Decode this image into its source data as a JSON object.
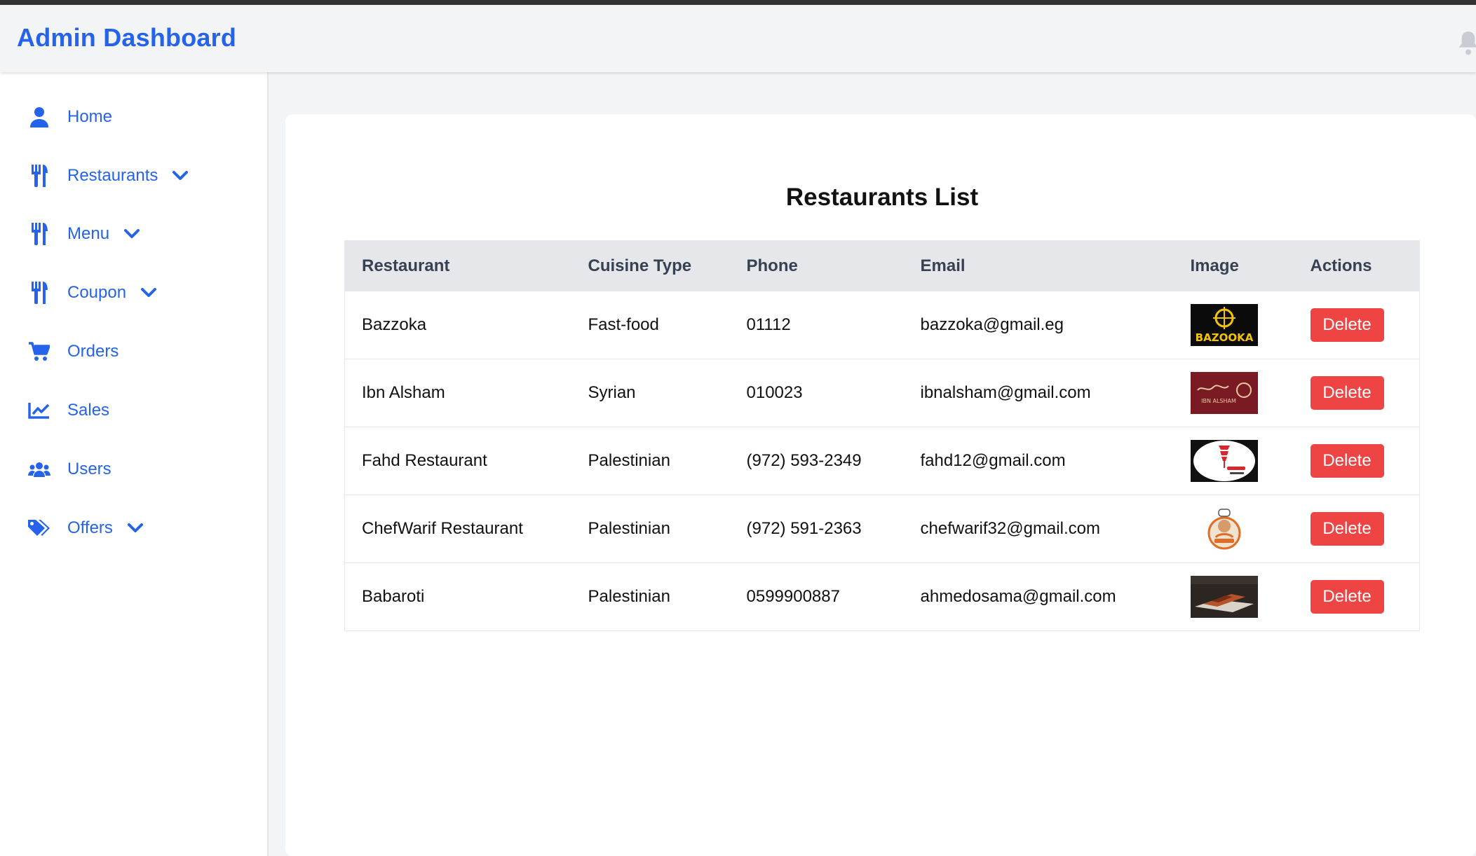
{
  "header": {
    "title": "Admin Dashboard",
    "bell_icon": "bell-icon"
  },
  "colors": {
    "accent": "#2563eb",
    "danger": "#ef4444",
    "header_bg": "#f3f4f6",
    "table_header_bg": "#e5e7eb"
  },
  "sidebar": {
    "items": [
      {
        "label": "Home",
        "icon": "user-icon",
        "has_dropdown": false
      },
      {
        "label": "Restaurants",
        "icon": "utensils-icon",
        "has_dropdown": true
      },
      {
        "label": "Menu",
        "icon": "utensils-icon",
        "has_dropdown": true
      },
      {
        "label": "Coupon",
        "icon": "utensils-icon",
        "has_dropdown": true
      },
      {
        "label": "Orders",
        "icon": "cart-icon",
        "has_dropdown": false
      },
      {
        "label": "Sales",
        "icon": "chart-line-icon",
        "has_dropdown": false
      },
      {
        "label": "Users",
        "icon": "users-icon",
        "has_dropdown": false
      },
      {
        "label": "Offers",
        "icon": "tags-icon",
        "has_dropdown": true
      }
    ]
  },
  "main": {
    "title": "Restaurants List",
    "table": {
      "headers": [
        "Restaurant",
        "Cuisine Type",
        "Phone",
        "Email",
        "Image",
        "Actions"
      ],
      "rows": [
        {
          "restaurant": "Bazzoka",
          "cuisine": "Fast-food",
          "phone": "01112",
          "email": "bazzoka@gmail.eg",
          "image_text": "BAZOOKA",
          "action": "Delete"
        },
        {
          "restaurant": "Ibn Alsham",
          "cuisine": "Syrian",
          "phone": "010023",
          "email": "ibnalsham@gmail.com",
          "image_text": "IBN ALSHAM",
          "action": "Delete"
        },
        {
          "restaurant": "Fahd Restaurant",
          "cuisine": "Palestinian",
          "phone": "(972) 593-2349",
          "email": "fahd12@gmail.com",
          "image_text": "",
          "action": "Delete"
        },
        {
          "restaurant": "ChefWarif Restaurant",
          "cuisine": "Palestinian",
          "phone": "(972) 591-2363",
          "email": "chefwarif32@gmail.com",
          "image_text": "",
          "action": "Delete"
        },
        {
          "restaurant": "Babaroti",
          "cuisine": "Palestinian",
          "phone": "0599900887",
          "email": "ahmedosama@gmail.com",
          "image_text": "",
          "action": "Delete"
        }
      ]
    }
  }
}
